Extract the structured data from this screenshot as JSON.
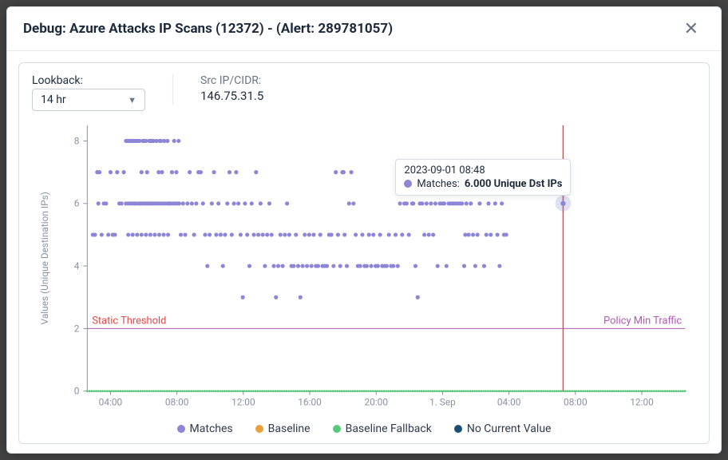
{
  "modal": {
    "title": "Debug: Azure Attacks IP Scans (12372) - (Alert: 289781057)"
  },
  "controls": {
    "lookback_label": "Lookback:",
    "lookback_value": "14 hr",
    "srcip_label": "Src IP/CIDR:",
    "srcip_value": "146.75.31.5"
  },
  "tooltip": {
    "timestamp": "2023-09-01 08:48",
    "series": "Matches:",
    "value": "6.000 Unique Dst IPs"
  },
  "legend": {
    "matches": "Matches",
    "baseline": "Baseline",
    "baseline_fallback": "Baseline Fallback",
    "no_current": "No Current Value"
  },
  "colors": {
    "matches": "#8d85d6",
    "baseline": "#e9a13b",
    "baseline_fallback": "#58c97b",
    "no_current": "#1b4f72",
    "threshold": "#e24a4a",
    "policy": "#b05ab5",
    "cursor": "#e24a4a"
  },
  "chart_data": {
    "type": "scatter",
    "ylabel": "Values (Unique Destination IPs)",
    "threshold_label": "Static Threshold",
    "policy_label": "Policy Min Traffic",
    "threshold_value": 2,
    "policy_min_traffic": 2,
    "ylim": [
      0,
      8.5
    ],
    "y_ticks": [
      0,
      2,
      4,
      6,
      8
    ],
    "x_ticks": [
      "04:00",
      "08:00",
      "12:00",
      "16:00",
      "20:00",
      "1. Sep",
      "04:00",
      "08:00",
      "12:00"
    ],
    "cursor_x_index": 203,
    "x_range_minutes": [
      0,
      2160
    ],
    "series": [
      {
        "name": "Matches",
        "color_ref": "matches",
        "points": [
          [
            20,
            5
          ],
          [
            28,
            5
          ],
          [
            36,
            7
          ],
          [
            40,
            6
          ],
          [
            44,
            7
          ],
          [
            52,
            5
          ],
          [
            60,
            6
          ],
          [
            68,
            6
          ],
          [
            76,
            5
          ],
          [
            84,
            7
          ],
          [
            92,
            5
          ],
          [
            100,
            5
          ],
          [
            108,
            7
          ],
          [
            116,
            6
          ],
          [
            124,
            6
          ],
          [
            132,
            7
          ],
          [
            140,
            8
          ],
          [
            144,
            8
          ],
          [
            148,
            8
          ],
          [
            152,
            8
          ],
          [
            156,
            8
          ],
          [
            160,
            8
          ],
          [
            164,
            8
          ],
          [
            168,
            8
          ],
          [
            172,
            8
          ],
          [
            176,
            8
          ],
          [
            180,
            8
          ],
          [
            184,
            8
          ],
          [
            188,
            8
          ],
          [
            192,
            6
          ],
          [
            196,
            7
          ],
          [
            200,
            8
          ],
          [
            204,
            8
          ],
          [
            208,
            8
          ],
          [
            212,
            8
          ],
          [
            216,
            7
          ],
          [
            220,
            6
          ],
          [
            224,
            8
          ],
          [
            228,
            8
          ],
          [
            232,
            8
          ],
          [
            236,
            8
          ],
          [
            240,
            8
          ],
          [
            140,
            6
          ],
          [
            148,
            6
          ],
          [
            156,
            6
          ],
          [
            164,
            6
          ],
          [
            172,
            6
          ],
          [
            180,
            6
          ],
          [
            188,
            6
          ],
          [
            196,
            6
          ],
          [
            204,
            6
          ],
          [
            212,
            6
          ],
          [
            220,
            6
          ],
          [
            228,
            6
          ],
          [
            236,
            6
          ],
          [
            244,
            6
          ],
          [
            252,
            6
          ],
          [
            260,
            6
          ],
          [
            268,
            6
          ],
          [
            276,
            6
          ],
          [
            284,
            6
          ],
          [
            292,
            6
          ],
          [
            300,
            6
          ],
          [
            308,
            6
          ],
          [
            316,
            6
          ],
          [
            324,
            6
          ],
          [
            332,
            6
          ],
          [
            148,
            5
          ],
          [
            164,
            5
          ],
          [
            180,
            5
          ],
          [
            196,
            5
          ],
          [
            212,
            5
          ],
          [
            228,
            5
          ],
          [
            244,
            5
          ],
          [
            260,
            5
          ],
          [
            276,
            5
          ],
          [
            292,
            5
          ],
          [
            250,
            8
          ],
          [
            258,
            7
          ],
          [
            262,
            8
          ],
          [
            266,
            8
          ],
          [
            270,
            7
          ],
          [
            278,
            8
          ],
          [
            290,
            8
          ],
          [
            298,
            6
          ],
          [
            306,
            7
          ],
          [
            314,
            8
          ],
          [
            322,
            7
          ],
          [
            330,
            8
          ],
          [
            338,
            5
          ],
          [
            346,
            6
          ],
          [
            354,
            5
          ],
          [
            362,
            6
          ],
          [
            370,
            7
          ],
          [
            378,
            6
          ],
          [
            386,
            5
          ],
          [
            394,
            6
          ],
          [
            402,
            7
          ],
          [
            410,
            7
          ],
          [
            418,
            6
          ],
          [
            426,
            5
          ],
          [
            434,
            4
          ],
          [
            442,
            5
          ],
          [
            450,
            6
          ],
          [
            458,
            7
          ],
          [
            466,
            5
          ],
          [
            474,
            6
          ],
          [
            482,
            5
          ],
          [
            490,
            4
          ],
          [
            498,
            5
          ],
          [
            506,
            6
          ],
          [
            514,
            7
          ],
          [
            522,
            5
          ],
          [
            530,
            6
          ],
          [
            538,
            7
          ],
          [
            546,
            6
          ],
          [
            554,
            5
          ],
          [
            562,
            3
          ],
          [
            570,
            6
          ],
          [
            578,
            5
          ],
          [
            586,
            4
          ],
          [
            594,
            6
          ],
          [
            602,
            5
          ],
          [
            610,
            7
          ],
          [
            618,
            5
          ],
          [
            626,
            6
          ],
          [
            634,
            5
          ],
          [
            642,
            4
          ],
          [
            650,
            5
          ],
          [
            658,
            6
          ],
          [
            666,
            5
          ],
          [
            674,
            4
          ],
          [
            682,
            3
          ],
          [
            690,
            4
          ],
          [
            698,
            5
          ],
          [
            706,
            4
          ],
          [
            714,
            5
          ],
          [
            722,
            6
          ],
          [
            730,
            5
          ],
          [
            738,
            4
          ],
          [
            746,
            4
          ],
          [
            754,
            5
          ],
          [
            762,
            4
          ],
          [
            770,
            3
          ],
          [
            778,
            4
          ],
          [
            786,
            5
          ],
          [
            794,
            4
          ],
          [
            802,
            5
          ],
          [
            810,
            4
          ],
          [
            818,
            5
          ],
          [
            826,
            4
          ],
          [
            834,
            4
          ],
          [
            842,
            5
          ],
          [
            850,
            4
          ],
          [
            858,
            4
          ],
          [
            866,
            4
          ],
          [
            874,
            5
          ],
          [
            882,
            5
          ],
          [
            890,
            4
          ],
          [
            898,
            7
          ],
          [
            906,
            5
          ],
          [
            914,
            4
          ],
          [
            922,
            7
          ],
          [
            926,
            7
          ],
          [
            930,
            5
          ],
          [
            938,
            4
          ],
          [
            946,
            6
          ],
          [
            954,
            7
          ],
          [
            962,
            6
          ],
          [
            970,
            5
          ],
          [
            978,
            4
          ],
          [
            986,
            4
          ],
          [
            994,
            5
          ],
          [
            1002,
            4
          ],
          [
            1010,
            4
          ],
          [
            1018,
            5
          ],
          [
            1026,
            4
          ],
          [
            1034,
            5
          ],
          [
            1042,
            4
          ],
          [
            1050,
            4
          ],
          [
            1058,
            5
          ],
          [
            1066,
            4
          ],
          [
            1074,
            4
          ],
          [
            1082,
            4
          ],
          [
            1090,
            5
          ],
          [
            1098,
            4
          ],
          [
            1106,
            4
          ],
          [
            1114,
            5
          ],
          [
            1122,
            4
          ],
          [
            1130,
            6
          ],
          [
            1138,
            5
          ],
          [
            1146,
            6
          ],
          [
            1154,
            6
          ],
          [
            1162,
            5
          ],
          [
            1170,
            7
          ],
          [
            1174,
            6
          ],
          [
            1178,
            6
          ],
          [
            1186,
            4
          ],
          [
            1194,
            3
          ],
          [
            1202,
            6
          ],
          [
            1210,
            6
          ],
          [
            1218,
            5
          ],
          [
            1226,
            6
          ],
          [
            1234,
            5
          ],
          [
            1242,
            6
          ],
          [
            1250,
            5
          ],
          [
            1258,
            6
          ],
          [
            1266,
            4
          ],
          [
            1274,
            6
          ],
          [
            1282,
            6
          ],
          [
            1290,
            6
          ],
          [
            1298,
            4
          ],
          [
            1306,
            6
          ],
          [
            1314,
            6
          ],
          [
            1322,
            6
          ],
          [
            1330,
            6
          ],
          [
            1338,
            6
          ],
          [
            1346,
            6
          ],
          [
            1354,
            6
          ],
          [
            1362,
            4
          ],
          [
            1366,
            5
          ],
          [
            1370,
            6
          ],
          [
            1378,
            5
          ],
          [
            1386,
            6
          ],
          [
            1394,
            5
          ],
          [
            1402,
            4
          ],
          [
            1410,
            5
          ],
          [
            1418,
            6
          ],
          [
            1426,
            7
          ],
          [
            1434,
            4
          ],
          [
            1442,
            5
          ],
          [
            1450,
            6
          ],
          [
            1458,
            5
          ],
          [
            1466,
            7
          ],
          [
            1474,
            6
          ],
          [
            1482,
            5
          ],
          [
            1490,
            4
          ],
          [
            1498,
            6
          ],
          [
            1506,
            5
          ],
          [
            1514,
            5
          ]
        ]
      },
      {
        "name": "Baseline Fallback",
        "color_ref": "baseline_fallback",
        "points_y0_from_to": [
          0,
          2160,
          8
        ]
      }
    ]
  }
}
